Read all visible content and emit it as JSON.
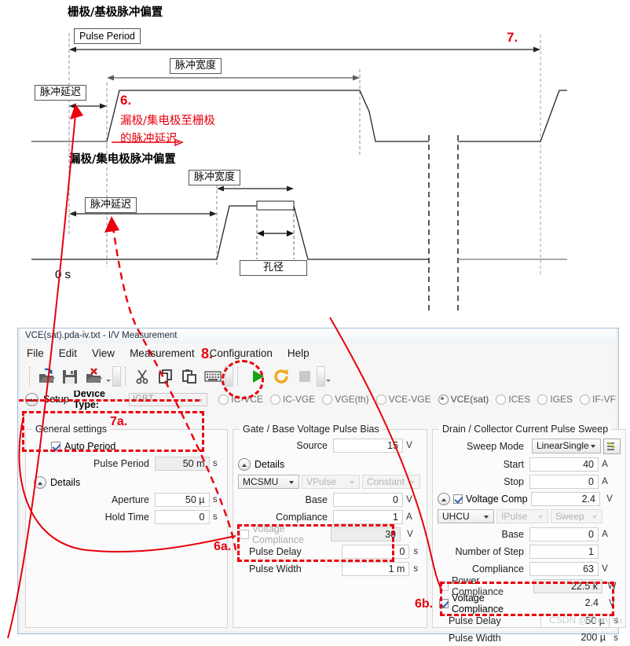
{
  "diagram": {
    "gate_title": "栅极/基极脉冲偏置",
    "drain_title": "漏极/集电极脉冲偏置",
    "pulse_period_label": "Pulse Period",
    "pulse_width_label_top": "脉冲宽度",
    "pulse_delay_label_top": "脉冲延迟",
    "pulse_width_label_bottom": "脉冲宽度",
    "pulse_delay_label_bottom": "脉冲延迟",
    "aperture_label": "孔径",
    "zero_label": "0 s",
    "note6_num": "6.",
    "note6_line1": "漏极/集电极至栅极",
    "note6_line2": "的脉冲延迟",
    "note7_num": "7.",
    "accent_red": "#e8000d"
  },
  "window": {
    "title": "VCE(sat).pda-iv.txt - I/V Measurement",
    "menu": [
      "File",
      "Edit",
      "View",
      "Measurement",
      "Configuration",
      "Help"
    ],
    "toolbar": [
      {
        "name": "open-file-icon"
      },
      {
        "name": "save-file-icon"
      },
      {
        "name": "delete-file-icon"
      },
      {
        "name": "cut-icon"
      },
      {
        "name": "copy-icon"
      },
      {
        "name": "paste-icon"
      },
      {
        "name": "keyboard-icon"
      },
      {
        "name": "run-icon"
      },
      {
        "name": "repeat-icon"
      },
      {
        "name": "stop-icon"
      }
    ],
    "note8": "8.",
    "watermark": "CSDN @Eren-Yu"
  },
  "setup": {
    "setup_label": "Setup",
    "device_type_label": "Device Type:",
    "device_type_value": "IGBT",
    "measure_modes": [
      {
        "label": "IC-VCE",
        "selected": false
      },
      {
        "label": "IC-VGE",
        "selected": false
      },
      {
        "label": "VGE(th)",
        "selected": false
      },
      {
        "label": "VCE-VGE",
        "selected": false
      },
      {
        "label": "VCE(sat)",
        "selected": true
      },
      {
        "label": "ICES",
        "selected": false
      },
      {
        "label": "IGES",
        "selected": false
      },
      {
        "label": "IF-VF",
        "selected": false
      }
    ]
  },
  "general": {
    "title": "General settings",
    "auto_period_label": "Auto Period",
    "auto_period_checked": true,
    "pulse_period_label": "Pulse Period",
    "pulse_period_value": "50 m",
    "pulse_period_unit": "s",
    "details_label": "Details",
    "aperture_label": "Aperture",
    "aperture_value": "50 µ",
    "aperture_unit": "s",
    "hold_time_label": "Hold Time",
    "hold_time_value": "0",
    "hold_time_unit": "s",
    "note7a": "7a."
  },
  "gate": {
    "title": "Gate / Base Voltage Pulse Bias",
    "source_label": "Source",
    "source_value": "15",
    "source_unit": "V",
    "details_label": "Details",
    "unit_select": "MCSMU",
    "mode_select": "VPulse",
    "func_select": "Constant",
    "rows": [
      {
        "label": "Base",
        "value": "0",
        "unit": "V",
        "gray": false
      },
      {
        "label": "Compliance",
        "value": "1",
        "unit": "A",
        "gray": false
      }
    ],
    "voltage_compliance_label": "Voltage Compliance",
    "voltage_compliance_value": "30",
    "voltage_compliance_unit": "V",
    "voltage_compliance_checked": false,
    "pulse_delay_label": "Pulse Delay",
    "pulse_delay_value": "0",
    "pulse_delay_unit": "s",
    "pulse_width_label": "Pulse Width",
    "pulse_width_value": "1 m",
    "pulse_width_unit": "s",
    "note6a": "6a."
  },
  "drain": {
    "title": "Drain / Collector Current Pulse Sweep",
    "sweep_mode_label": "Sweep Mode",
    "sweep_mode_value": "LinearSingle",
    "sweep_icon": "sweep-settings-icon",
    "start_label": "Start",
    "start_value": "40",
    "start_unit": "A",
    "stop_label": "Stop",
    "stop_value": "0",
    "stop_unit": "A",
    "vcomp_top_label": "Voltage Complia",
    "vcomp_top_value": "2.4",
    "vcomp_top_unit": "V",
    "vcomp_top_checked": true,
    "unit_select": "UHCU",
    "mode_select": "IPulse",
    "func_select": "Sweep",
    "base_label": "Base",
    "base_value": "0",
    "base_unit": "A",
    "step_label": "Number of Step",
    "step_value": "1",
    "step_unit": "",
    "compliance_label": "Compliance",
    "compliance_value": "63",
    "compliance_unit": "V",
    "power_compliance_label": "Power Compliance",
    "power_compliance_value": "22.5 k",
    "power_compliance_unit": "W",
    "power_compliance_checked": false,
    "voltage_compliance_label": "Voltage Compliance",
    "voltage_compliance_value": "2.4",
    "voltage_compliance_unit": "V",
    "voltage_compliance_checked": true,
    "pulse_delay_label": "Pulse Delay",
    "pulse_delay_value": "50 µ",
    "pulse_delay_unit": "s",
    "pulse_width_label": "Pulse Width",
    "pulse_width_value": "200 µ",
    "pulse_width_unit": "s",
    "note6b": "6b."
  }
}
